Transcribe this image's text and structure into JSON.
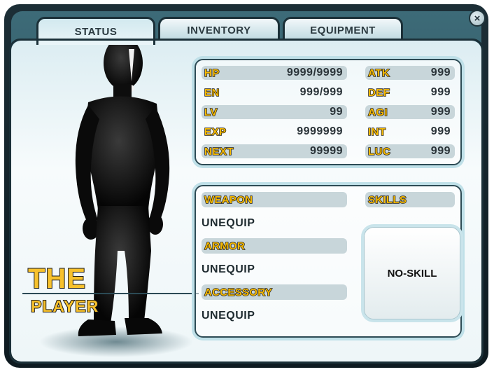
{
  "tabs": [
    {
      "label": "STATUS",
      "active": true
    },
    {
      "label": "INVENTORY",
      "active": false
    },
    {
      "label": "EQUIPMENT",
      "active": false
    }
  ],
  "close_icon": "×",
  "character": {
    "name_line1": "THE",
    "name_line2": "PLAYER"
  },
  "stats_left": [
    {
      "label": "HP",
      "value": "9999/9999"
    },
    {
      "label": "EN",
      "value": "999/999"
    },
    {
      "label": "LV",
      "value": "99"
    },
    {
      "label": "EXP",
      "value": "9999999"
    },
    {
      "label": "NEXT",
      "value": "99999"
    }
  ],
  "stats_right": [
    {
      "label": "ATK",
      "value": "999"
    },
    {
      "label": "DEF",
      "value": "999"
    },
    {
      "label": "AGI",
      "value": "999"
    },
    {
      "label": "INT",
      "value": "999"
    },
    {
      "label": "LUC",
      "value": "999"
    }
  ],
  "equipment": {
    "weapon_label": "WEAPON",
    "weapon_value": "UNEQUIP",
    "armor_label": "ARMOR",
    "armor_value": "UNEQUIP",
    "accessory_label": "ACCESSORY",
    "accessory_value": "UNEQUIP"
  },
  "skills": {
    "label": "SKILLS",
    "slot_value": "NO-SKILL"
  },
  "colors": {
    "accent_gold": "#f5b800",
    "frame_teal": "#3d6b78",
    "panel_light": "#eef6f8"
  }
}
